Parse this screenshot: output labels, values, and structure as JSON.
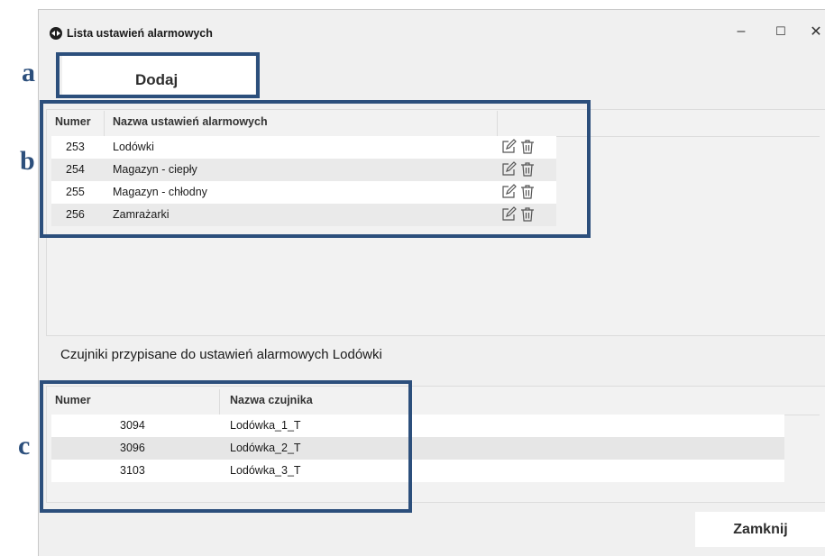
{
  "window": {
    "title": "Lista ustawień alarmowych",
    "controls": {
      "minimize": "–",
      "maximize": "☐",
      "close": "✕"
    }
  },
  "tab": {
    "label": "Dodaj"
  },
  "alarm_table": {
    "columns": [
      "Numer",
      "Nazwa ustawień alarmowych"
    ],
    "rows": [
      {
        "number": "253",
        "name": "Lodówki"
      },
      {
        "number": "254",
        "name": "Magazyn - ciepły"
      },
      {
        "number": "255",
        "name": "Magazyn - chłodny"
      },
      {
        "number": "256",
        "name": "Zamrażarki"
      }
    ]
  },
  "sensors_section": {
    "label": "Czujniki przypisane do ustawień alarmowych Lodówki"
  },
  "sensor_table": {
    "columns": [
      "Numer",
      "Nazwa czujnika"
    ],
    "rows": [
      {
        "number": "3094",
        "name": "Lodówka_1_T"
      },
      {
        "number": "3096",
        "name": "Lodówka_2_T"
      },
      {
        "number": "3103",
        "name": "Lodówka_3_T"
      }
    ]
  },
  "footer": {
    "close_label": "Zamknij"
  },
  "annotations": [
    "a",
    "b",
    "c"
  ],
  "colors": {
    "annotation": "#2c4f7c",
    "window_bg": "#f0f0f0",
    "row_alt": "#eaeaea"
  }
}
